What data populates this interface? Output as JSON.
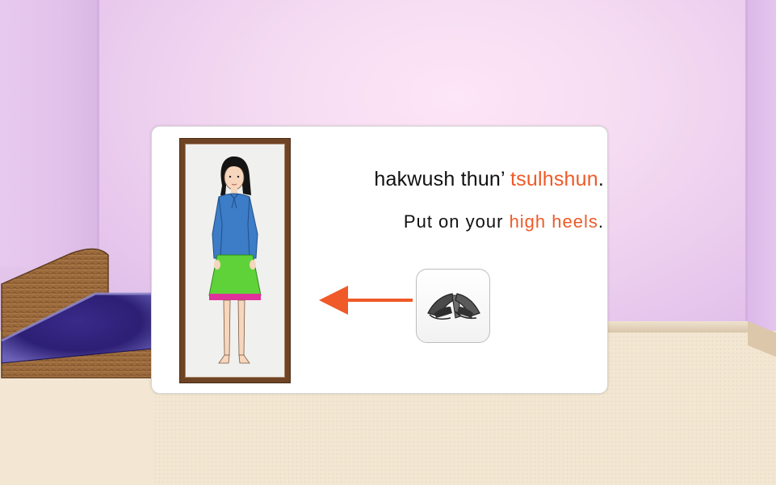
{
  "prompt": {
    "native_prefix": "hakwush thun’ ",
    "native_target": "tsulhshun",
    "native_suffix": ".",
    "english_prefix": "Put on your ",
    "english_target": "high heels",
    "english_suffix": "."
  },
  "icons": {
    "item": "high-heels-icon",
    "arrow": "arrow-left-icon",
    "portrait": "girl-portrait"
  },
  "colors": {
    "highlight": "#ef5a28",
    "frame": "#6f4424",
    "wall": "#f6dcf2"
  }
}
